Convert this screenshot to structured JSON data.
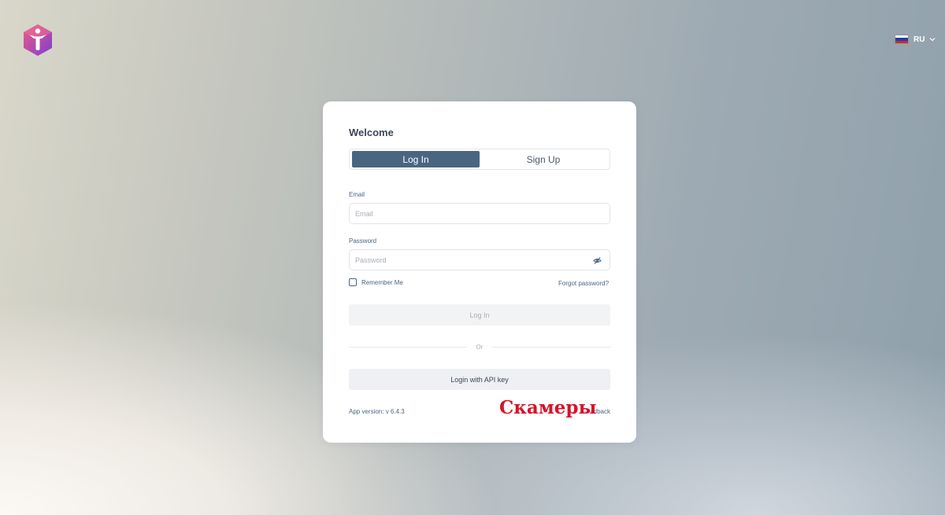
{
  "header": {
    "logo_icon": "hexagon-person-logo",
    "language": {
      "code": "RU",
      "flag_icon": "russia-flag-icon",
      "flag_colors": [
        "#ffffff",
        "#1c3faa",
        "#d52b1e"
      ]
    }
  },
  "card": {
    "welcome": "Welcome",
    "tabs": [
      {
        "label": "Log In",
        "active": true
      },
      {
        "label": "Sign Up",
        "active": false
      }
    ],
    "email": {
      "label": "Email",
      "value": "",
      "placeholder": "Email"
    },
    "password": {
      "label": "Password",
      "value": "",
      "placeholder": "Password",
      "toggle_icon": "eye-off-icon"
    },
    "remember_me": {
      "label": "Remember Me",
      "checked": false
    },
    "forgot_password": "Forgot password?",
    "login_button": "Log In",
    "divider": "Or",
    "api_key_button": "Login with API key",
    "version": "App version: v 6.4.3",
    "feedback_link": "Feedback",
    "overlay_text": "Скамеры"
  },
  "colors": {
    "accent": "#4a6580",
    "overlay_red": "#d6142a",
    "logo_pink": "#e0457b",
    "logo_purple": "#7b3fd0"
  }
}
